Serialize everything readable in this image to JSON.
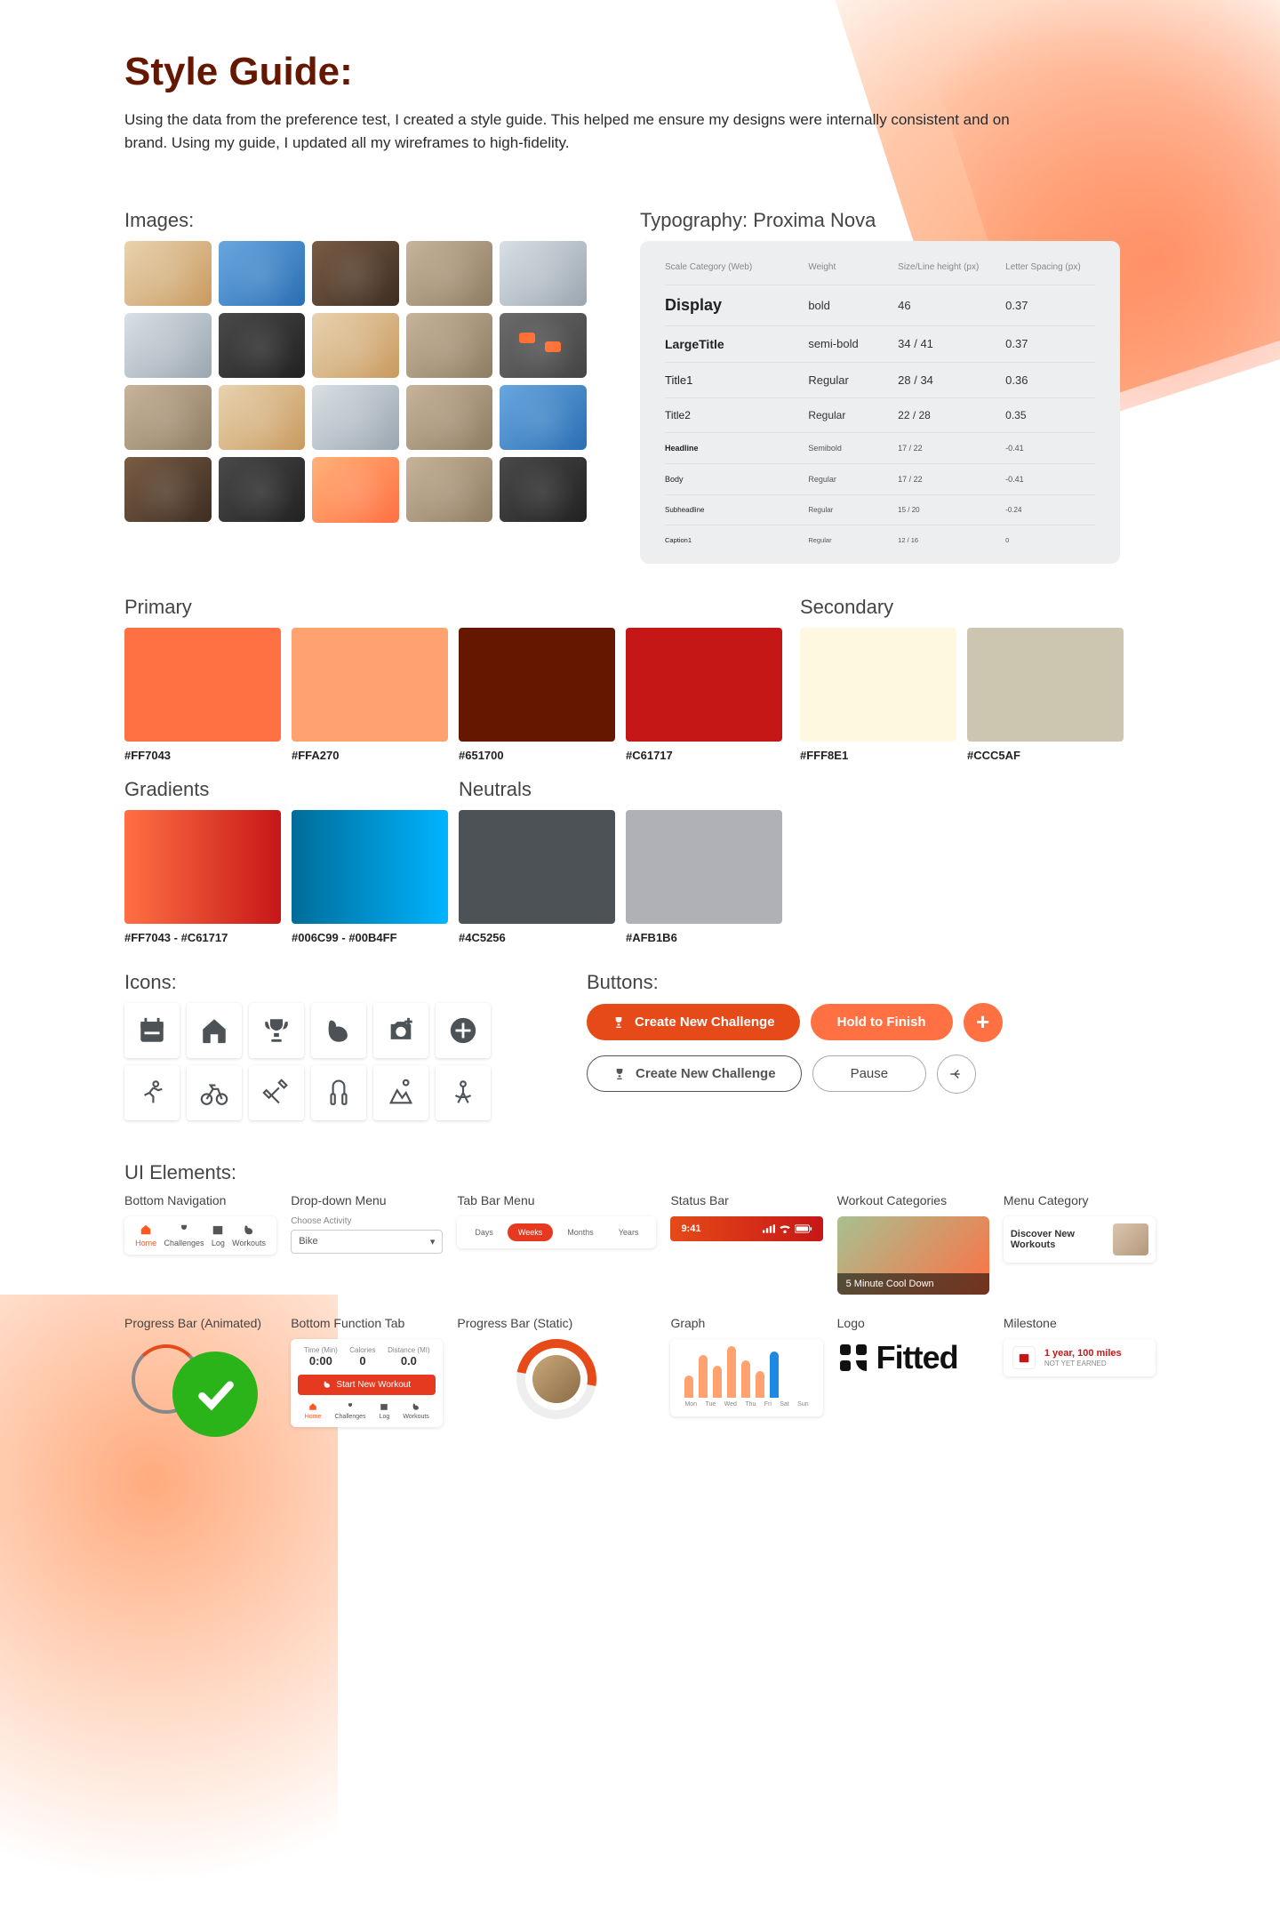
{
  "page": {
    "title": "Style Guide:",
    "intro": "Using the data from the preference test, I created a style guide. This helped me ensure my designs were internally consistent and on brand. Using my guide, I updated all my wireframes to high-fidelity."
  },
  "sections": {
    "images": "Images:",
    "typography": "Typography: Proxima Nova",
    "primary": "Primary",
    "secondary": "Secondary",
    "gradients": "Gradients",
    "neutrals": "Neutrals",
    "icons": "Icons:",
    "buttons": "Buttons:",
    "ui": "UI Elements:"
  },
  "typography": {
    "headers": {
      "c1": "Scale Category (Web)",
      "c2": "Weight",
      "c3": "Size/Line height (px)",
      "c4": "Letter Spacing (px)"
    },
    "rows": [
      {
        "cat": "Display",
        "weight": "bold",
        "size": "46",
        "ls": "0.37"
      },
      {
        "cat": "LargeTitle",
        "weight": "semi-bold",
        "size": "34 / 41",
        "ls": "0.37"
      },
      {
        "cat": "Title1",
        "weight": "Regular",
        "size": "28 / 34",
        "ls": "0.36"
      },
      {
        "cat": "Title2",
        "weight": "Regular",
        "size": "22 / 28",
        "ls": "0.35"
      },
      {
        "cat": "Headline",
        "weight": "Semibold",
        "size": "17 / 22",
        "ls": "-0.41"
      },
      {
        "cat": "Body",
        "weight": "Regular",
        "size": "17 / 22",
        "ls": "-0.41"
      },
      {
        "cat": "Subheadline",
        "weight": "Regular",
        "size": "15 / 20",
        "ls": "-0.24"
      },
      {
        "cat": "Caption1",
        "weight": "Regular",
        "size": "12 / 16",
        "ls": "0"
      }
    ]
  },
  "colors": {
    "primary": [
      {
        "hex": "#FF7043"
      },
      {
        "hex": "#FFA270"
      },
      {
        "hex": "#651700"
      },
      {
        "hex": "#C61717"
      }
    ],
    "secondary": [
      {
        "hex": "#FFF8E1"
      },
      {
        "hex": "#CCC5AF"
      }
    ],
    "gradients": [
      {
        "label": "#FF7043 - #C61717",
        "css": "linear-gradient(90deg,#FF7043,#C61717)"
      },
      {
        "label": "#006C99 - #00B4FF",
        "css": "linear-gradient(90deg,#006C99,#00B4FF)"
      }
    ],
    "neutrals": [
      {
        "hex": "#4C5256"
      },
      {
        "hex": "#AFB1B6"
      }
    ]
  },
  "buttons": {
    "createPrimary": "Create New Challenge",
    "holdFinish": "Hold to Finish",
    "createOutline": "Create New Challenge",
    "pause": "Pause"
  },
  "ui": {
    "labels": {
      "bottomNav": "Bottom Navigation",
      "dropdown": "Drop-down Menu",
      "tabbar": "Tab Bar Menu",
      "status": "Status Bar",
      "workoutCat": "Workout Categories",
      "menuCat": "Menu Category",
      "progressAnim": "Progress Bar (Animated)",
      "bottomFunc": "Bottom Function Tab",
      "progressStatic": "Progress Bar (Static)",
      "graph": "Graph",
      "logo": "Logo",
      "milestone": "Milestone"
    },
    "bottomNav": [
      {
        "label": "Home"
      },
      {
        "label": "Challenges"
      },
      {
        "label": "Log"
      },
      {
        "label": "Workouts"
      }
    ],
    "dropdown": {
      "label": "Choose Activity",
      "value": "Bike"
    },
    "tabbar": [
      {
        "label": "Days"
      },
      {
        "label": "Weeks"
      },
      {
        "label": "Months"
      },
      {
        "label": "Years"
      }
    ],
    "statusTime": "9:41",
    "workoutCaption": "5 Minute Cool Down",
    "menuCatText": "Discover New Workouts",
    "bottomFunc": {
      "stats": [
        {
          "label": "Time (Min)",
          "value": "0:00"
        },
        {
          "label": "Calories",
          "value": "0"
        },
        {
          "label": "Distance (MI)",
          "value": "0.0"
        }
      ],
      "start": "Start New Workout"
    },
    "graphDays": [
      "Mon",
      "Tue",
      "Wed",
      "Thu",
      "Fri",
      "Sat",
      "Sun"
    ],
    "logoText": "Fitted",
    "milestone": {
      "title": "1 year, 100 miles",
      "sub": "NOT YET EARNED"
    }
  },
  "chart_data": {
    "type": "bar",
    "categories": [
      "Mon",
      "Tue",
      "Wed",
      "Thu",
      "Fri",
      "Sat",
      "Sun"
    ],
    "values": [
      25,
      48,
      36,
      58,
      42,
      30,
      52
    ],
    "highlight_index": 6,
    "title": "",
    "xlabel": "",
    "ylabel": "",
    "ylim": [
      0,
      60
    ]
  }
}
